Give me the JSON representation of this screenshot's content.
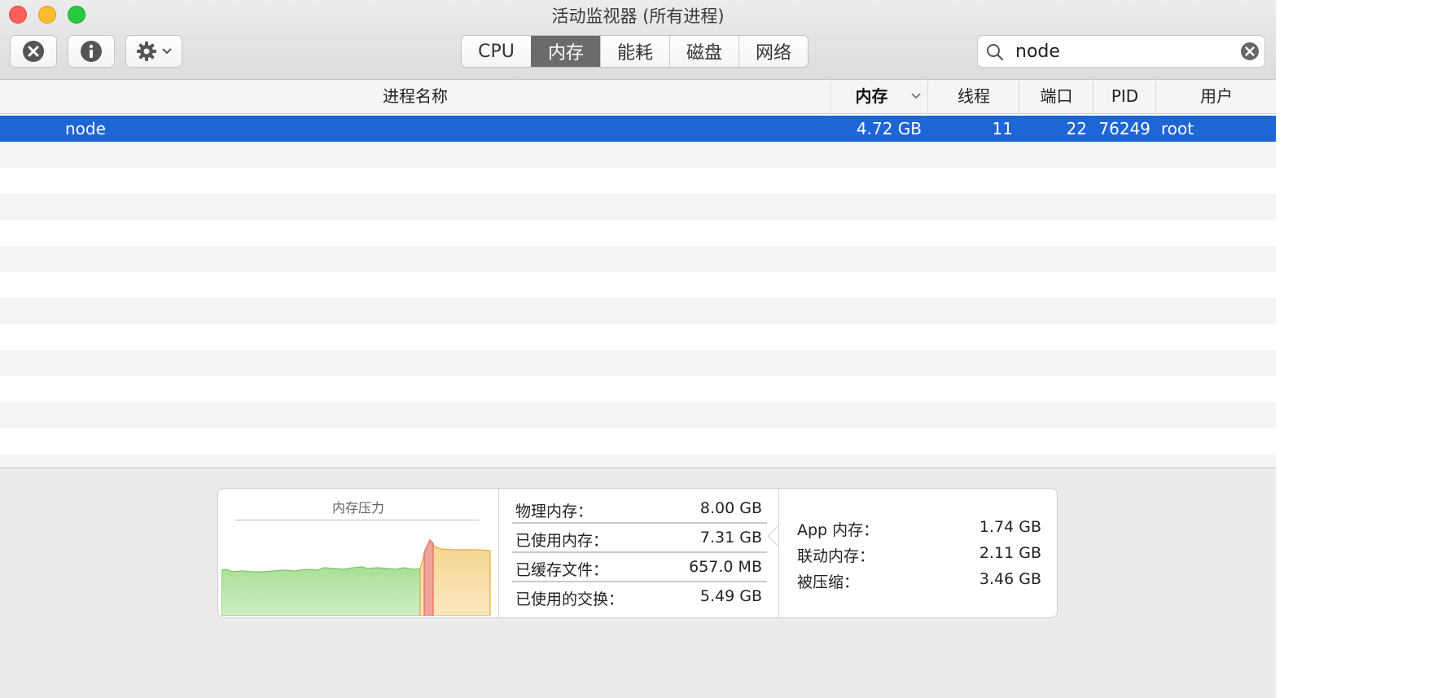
{
  "window": {
    "title": "活动监视器 (所有进程)"
  },
  "toolbar": {
    "stop_icon": "stop-process-icon",
    "info_icon": "info-icon",
    "action_icon": "gear-icon",
    "tabs": [
      {
        "label": "CPU",
        "active": false
      },
      {
        "label": "内存",
        "active": true
      },
      {
        "label": "能耗",
        "active": false
      },
      {
        "label": "磁盘",
        "active": false
      },
      {
        "label": "网络",
        "active": false
      }
    ],
    "search": {
      "value": "node",
      "placeholder": "搜索"
    }
  },
  "table": {
    "columns": [
      "进程名称",
      "内存",
      "线程",
      "端口",
      "PID",
      "用户"
    ],
    "sorted_column": "内存",
    "rows": [
      {
        "name": "node",
        "memory": "4.72 GB",
        "threads": "11",
        "ports": "22",
        "pid": "76249",
        "user": "root",
        "selected": true
      }
    ]
  },
  "memory_panel": {
    "pressure_title": "内存压力",
    "physical_label": "物理内存：",
    "physical_value": "8.00 GB",
    "used_label": "已使用内存：",
    "used_value": "7.31 GB",
    "cached_label": "已缓存文件：",
    "cached_value": "657.0 MB",
    "swap_label": "已使用的交换：",
    "swap_value": "5.49 GB",
    "app_label": "App 内存：",
    "app_value": "1.74 GB",
    "wired_label": "联动内存：",
    "wired_value": "2.11 GB",
    "compressed_label": "被压缩：",
    "compressed_value": "3.46 GB"
  },
  "colors": {
    "selection": "#1e65d6",
    "pressure_green": "#8fd27c",
    "pressure_red": "#e46b63",
    "pressure_yellow": "#f2c46a"
  }
}
